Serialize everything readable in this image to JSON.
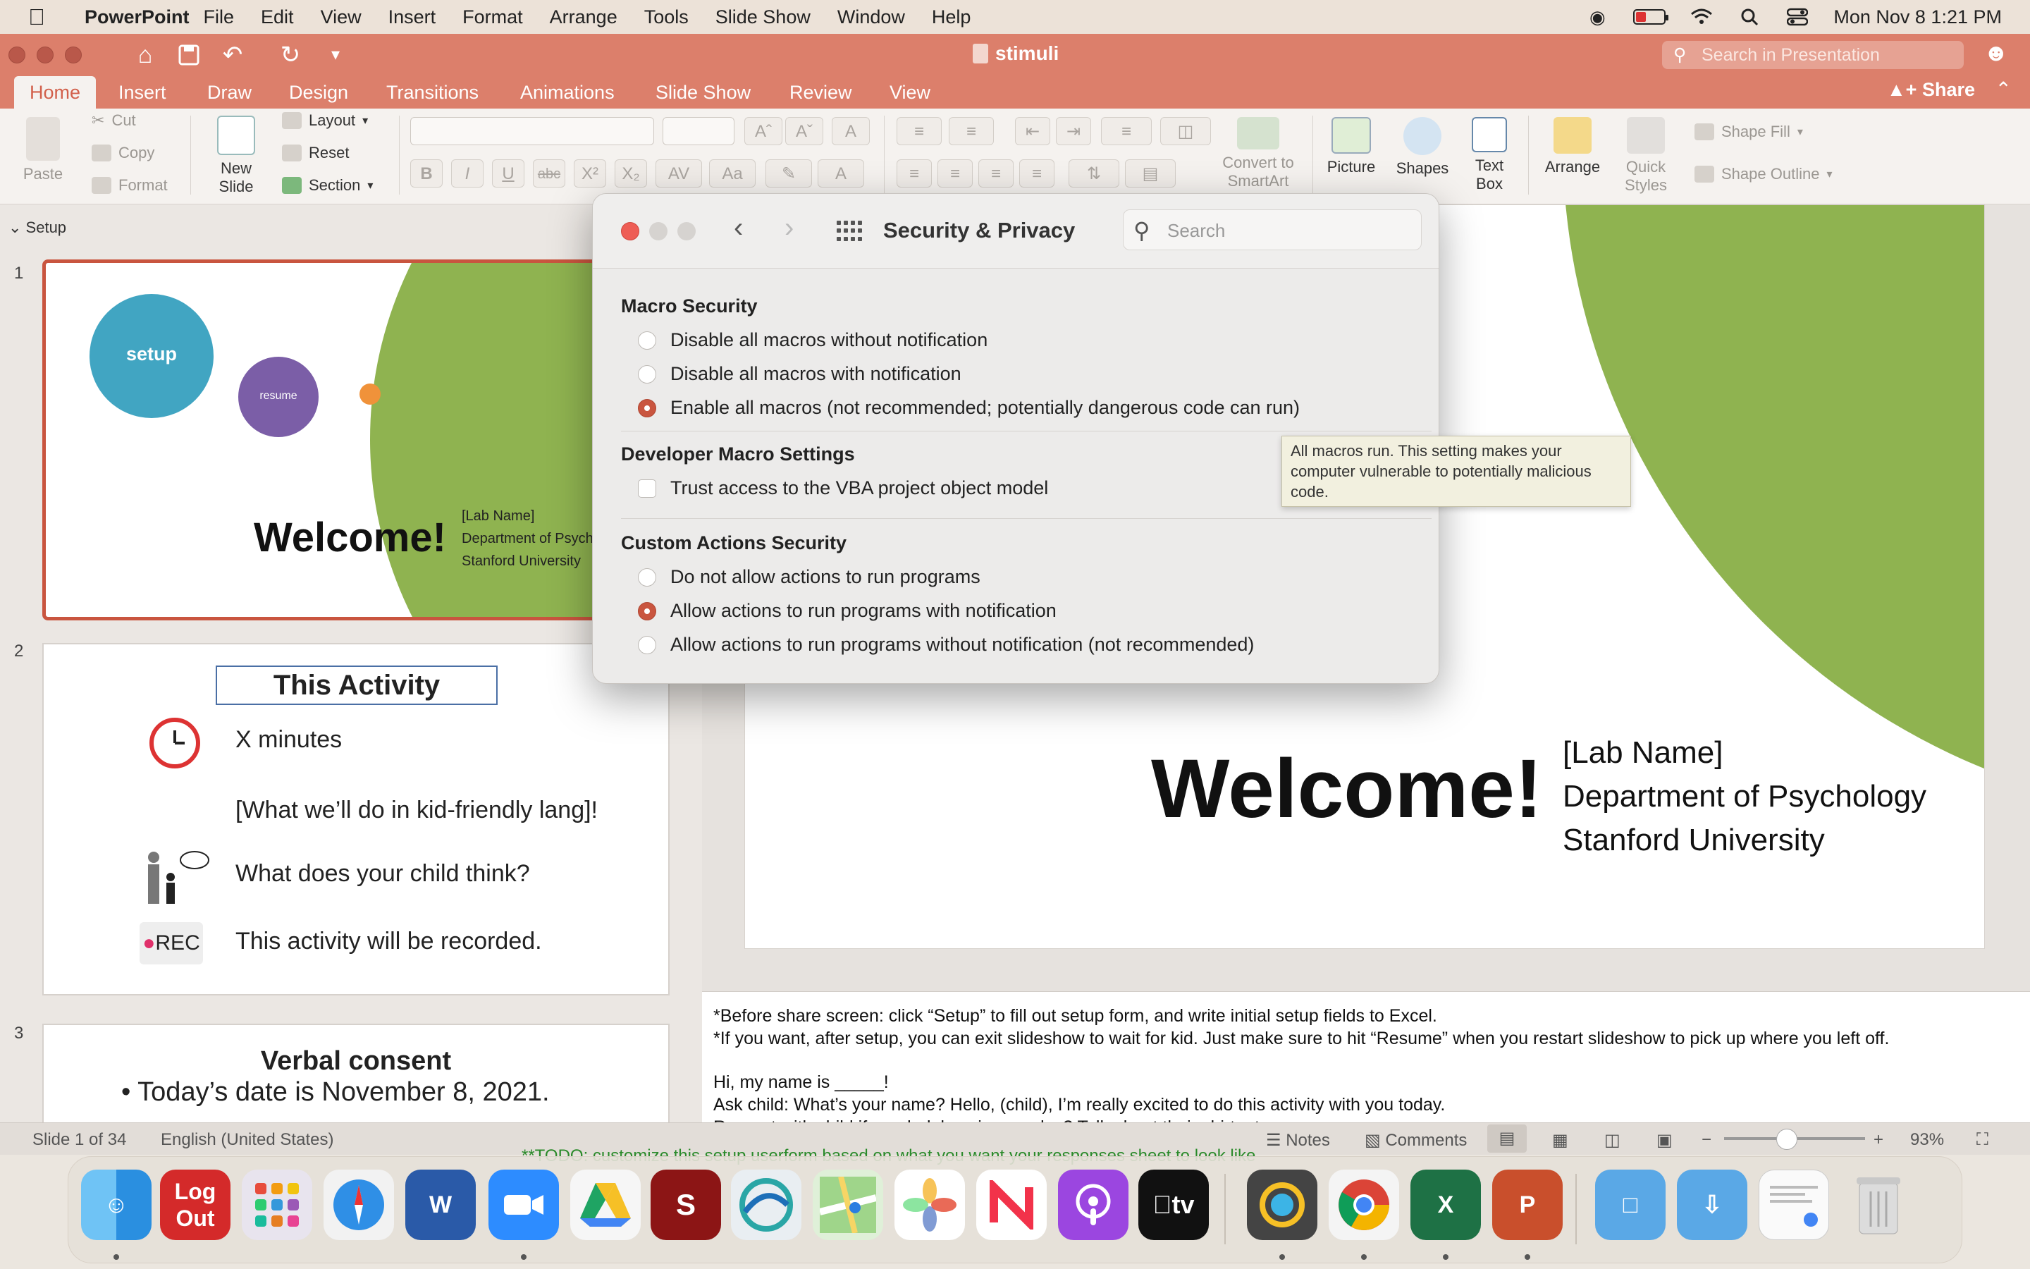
{
  "menubar": {
    "app_name": "PowerPoint",
    "items": [
      "File",
      "Edit",
      "View",
      "Insert",
      "Format",
      "Arrange",
      "Tools",
      "Slide Show",
      "Window",
      "Help"
    ],
    "clock": "Mon Nov 8  1:21 PM"
  },
  "window": {
    "title": "stimuli",
    "search_placeholder": "Search in Presentation"
  },
  "ribbon": {
    "tabs": [
      "Home",
      "Insert",
      "Draw",
      "Design",
      "Transitions",
      "Animations",
      "Slide Show",
      "Review",
      "View"
    ],
    "active_tab": "Home",
    "share_label": "Share"
  },
  "toolbar": {
    "paste": "Paste",
    "cut": "Cut",
    "copy": "Copy",
    "format": "Format",
    "new_slide_1": "New",
    "new_slide_2": "Slide",
    "layout": "Layout",
    "reset": "Reset",
    "section": "Section",
    "convert_1": "Convert to",
    "convert_2": "SmartArt",
    "picture": "Picture",
    "shapes": "Shapes",
    "text_box_1": "Text",
    "text_box_2": "Box",
    "arrange": "Arrange",
    "quick_styles_1": "Quick",
    "quick_styles_2": "Styles",
    "shape_fill": "Shape Fill",
    "shape_outline": "Shape Outline"
  },
  "thumbnails": {
    "section_name": "Setup",
    "slide1": {
      "num": "1",
      "setup_label": "setup",
      "resume_label": "resume",
      "welcome": "Welcome!",
      "lab": "[Lab Name]",
      "dept": "Department of Psych",
      "univ": "Stanford University"
    },
    "slide2": {
      "num": "2",
      "title": "This Activity",
      "minutes": "X minutes",
      "what": "[What we’ll do in kid-friendly lang]!",
      "child": "What does your child think?",
      "rec_badge": "REC",
      "recorded": "This activity will be recorded."
    },
    "slide3": {
      "num": "3",
      "title": "Verbal consent",
      "bullet1": "• Today’s date is November 8, 2021."
    }
  },
  "main_slide": {
    "welcome": "Welcome!",
    "lab": "[Lab Name]",
    "dept": "Department of Psychology",
    "univ": "Stanford University"
  },
  "notes": {
    "line1": "*Before share screen: click “Setup” to fill out setup form, and write initial setup fields to Excel.",
    "line2": "*If you want, after setup, you can exit slideshow to wait for kid. Just make sure to hit “Resume” when you restart slideshow to pick up where you left off.",
    "line3": "Hi, my name is _____!",
    "line4": "Ask child: What’s your name? Hello, (child), I’m really excited to do this activity with you today.",
    "line5": "Rapport with child if needed: how is your day? Talk about their shirt, etc."
  },
  "todo_text": "**TODO: customize this setup userform based on what you want your responses sheet to look like",
  "statusbar": {
    "slide_count": "Slide 1 of 34",
    "language": "English (United States)",
    "notes": "Notes",
    "comments": "Comments",
    "zoom": "93%"
  },
  "dialog": {
    "title": "Security & Privacy",
    "search_placeholder": "Search",
    "macro_heading": "Macro Security",
    "macro_options": [
      "Disable all macros without notification",
      "Disable all macros with notification",
      "Enable all macros (not recommended; potentially dangerous code can run)"
    ],
    "macro_selected_index": 2,
    "dev_heading": "Developer Macro Settings",
    "vba_trust": "Trust access to the VBA project object model",
    "custom_heading": "Custom Actions Security",
    "custom_options": [
      "Do not allow actions to run programs",
      "Allow actions to run programs with notification",
      "Allow actions to run programs without notification (not recommended)"
    ],
    "custom_selected_index": 1,
    "tooltip": "All macros run. This setting makes your computer vulnerable to potentially malicious code."
  },
  "dock": {
    "logout_1": "Log",
    "logout_2": "Out",
    "appletv_label": "tv"
  },
  "colors": {
    "accent": "#dc7f6b",
    "selected_radio": "#c9553f",
    "slide_green": "#8fb350",
    "setup_circle": "#41a5c2",
    "resume_circle": "#7b5ea7",
    "dot_orange": "#f0923a"
  }
}
